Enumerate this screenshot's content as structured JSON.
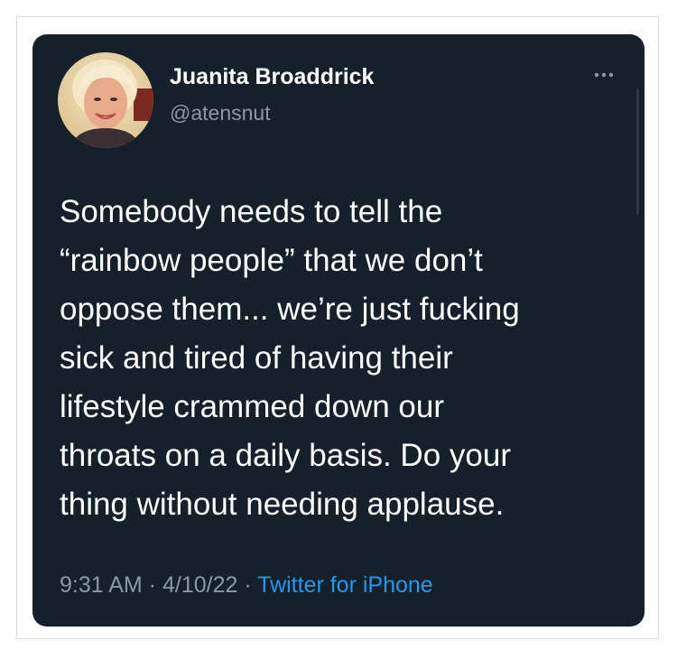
{
  "tweet": {
    "author_name": "Juanita Broaddrick",
    "author_handle": "@atensnut",
    "text": "Somebody needs to tell the\n“rainbow people” that we don’t\noppose them... we’re just fucking\nsick and tired of having their\nlifestyle crammed down our\nthroats on a daily basis.  Do your\nthing without needing applause.",
    "time": "9:31 AM",
    "separator": "·",
    "date": "4/10/22",
    "source": "Twitter for iPhone",
    "more_icon": "more-horizontal-icon"
  },
  "colors": {
    "card_background": "#15202b",
    "primary_text": "#ffffff",
    "secondary_text": "#8899a6",
    "link": "#1d9bf0"
  }
}
